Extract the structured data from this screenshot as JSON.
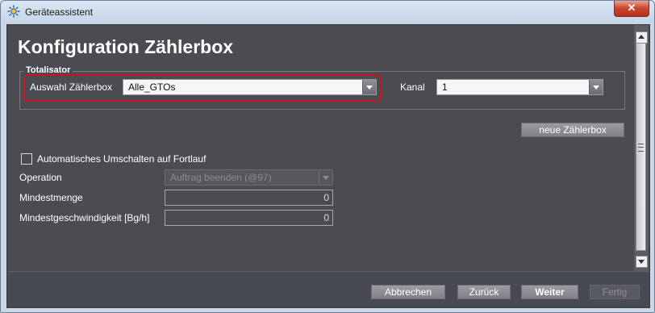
{
  "window": {
    "title": "Geräteassistent",
    "close_label": "✕"
  },
  "page": {
    "title": "Konfiguration Zählerbox"
  },
  "totalisator": {
    "legend": "Totalisator",
    "auswahl_label": "Auswahl Zählerbox",
    "auswahl_value": "Alle_GTOs",
    "kanal_label": "Kanal",
    "kanal_value": "1",
    "neue_button": "neue Zählerbox"
  },
  "options": {
    "auto_switch_label": "Automatisches Umschalten auf Fortlauf",
    "auto_switch_checked": false,
    "operation_label": "Operation",
    "operation_value": "Auftrag beenden (@97)",
    "mindestmenge_label": "Mindestmenge",
    "mindestmenge_value": "0",
    "mindestgeschw_label": "Mindestgeschwindigkeit [Bg/h]",
    "mindestgeschw_value": "0"
  },
  "footer": {
    "abbrechen": "Abbrechen",
    "zurueck": "Zurück",
    "weiter": "Weiter",
    "fertig": "Fertig"
  },
  "colors": {
    "highlight": "#d0101c",
    "panel_bg": "#4a4c52"
  }
}
